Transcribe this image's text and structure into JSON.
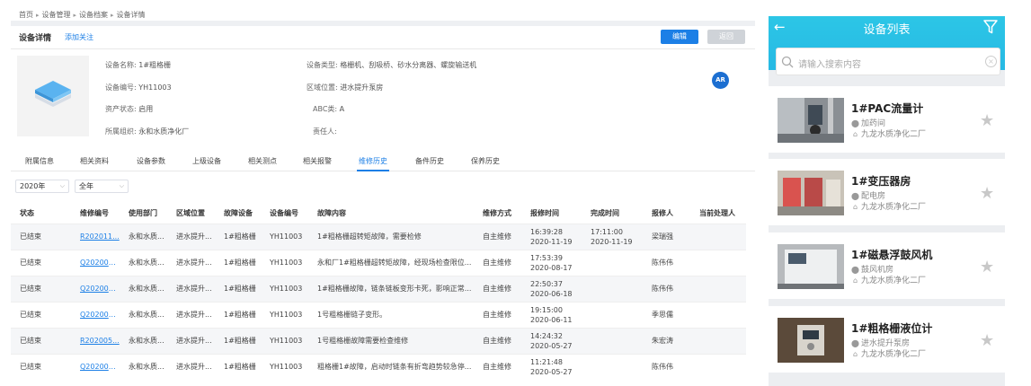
{
  "breadcrumb": [
    "首页",
    "设备管理",
    "设备档案",
    "设备详情"
  ],
  "header": {
    "title": "设备详情",
    "follow_label": "添加关注",
    "edit_label": "编辑",
    "back_label": "返回"
  },
  "info": {
    "name_label": "设备名称:",
    "name_value": "1#粗格栅",
    "code_label": "设备编号:",
    "code_value": "YH11003",
    "asset_label": "资产状态:",
    "asset_value": "启用",
    "org_label": "所属组织:",
    "org_value": "永和水质净化厂",
    "type_label": "设备类型:",
    "type_value": "格栅机、刮吸桥、砂水分离器、螺旋输送机",
    "area_label": "区域位置:",
    "area_value": "进水提升泵房",
    "abc_label": "ABC类:",
    "abc_value": "A",
    "owner_label": "责任人:",
    "owner_value": "",
    "ar_label": "AR"
  },
  "tabs": [
    "附属信息",
    "相关资料",
    "设备参数",
    "上级设备",
    "相关测点",
    "相关报警",
    "维修历史",
    "备件历史",
    "保养历史"
  ],
  "active_tab": "维修历史",
  "filters": {
    "year": "2020年",
    "period": "全年"
  },
  "table": {
    "columns": [
      "状态",
      "维修编号",
      "使用部门",
      "区域位置",
      "故障设备",
      "设备编号",
      "故障内容",
      "维修方式",
      "报修时间",
      "完成时间",
      "报修人",
      "当前处理人"
    ],
    "rows": [
      [
        "已结束",
        "R202011...",
        "永和水质...",
        "进水提升...",
        "1#粗格栅",
        "YH11003",
        "1#粗格栅超转矩故障，需要检修",
        "自主维修",
        "16:39:28",
        "2020-11-19",
        "17:11:00",
        "2020-11-19",
        "梁瑞强",
        ""
      ],
      [
        "已结束",
        "Q202008...",
        "永和水质...",
        "进水提升...",
        "1#粗格栅",
        "YH11003",
        "永和厂1#粗格栅超转矩故障，经现场检查限位...",
        "自主维修",
        "17:53:39",
        "2020-08-17",
        "",
        "",
        "陈伟伟",
        ""
      ],
      [
        "已结束",
        "Q202006...",
        "永和水质...",
        "进水提升...",
        "1#粗格栅",
        "YH11003",
        "1#粗格栅故障，链条链板变形卡死，影响正常...",
        "自主维修",
        "22:50:37",
        "2020-06-18",
        "",
        "",
        "陈伟伟",
        ""
      ],
      [
        "已结束",
        "Q202006...",
        "永和水质...",
        "进水提升...",
        "1#粗格栅",
        "YH11003",
        "1号粗格栅链子变形。",
        "自主维修",
        "19:15:00",
        "2020-06-11",
        "",
        "",
        "季思儒",
        ""
      ],
      [
        "已结束",
        "R202005...",
        "永和水质...",
        "进水提升...",
        "1#粗格栅",
        "YH11003",
        "1号粗格栅故障需要检查维修",
        "自主维修",
        "14:24:32",
        "2020-05-27",
        "",
        "",
        "朱宏涛",
        ""
      ],
      [
        "已结束",
        "Q202005...",
        "永和水质...",
        "进水提升...",
        "1#粗格栅",
        "YH11003",
        "粗格栅1#故障，启动时链条有折弯趋势较急停...",
        "自主维修",
        "11:21:48",
        "2020-05-27",
        "",
        "",
        "陈伟伟",
        ""
      ]
    ]
  },
  "mobile": {
    "title": "设备列表",
    "search_placeholder": "请输入搜索内容",
    "items": [
      {
        "name": "1#PAC流量计",
        "location": "加药间",
        "org": "九龙水质净化二厂"
      },
      {
        "name": "1#变压器房",
        "location": "配电房",
        "org": "九龙水质净化二厂"
      },
      {
        "name": "1#磁悬浮鼓风机",
        "location": "鼓风机房",
        "org": "九龙水质净化二厂"
      },
      {
        "name": "1#粗格栅液位计",
        "location": "进水提升泵房",
        "org": "九龙水质净化二厂"
      }
    ]
  },
  "colors": {
    "primary": "#1c7fe6",
    "mobile_header": "#2cc6e6",
    "stripe": "#f5f6f8"
  }
}
